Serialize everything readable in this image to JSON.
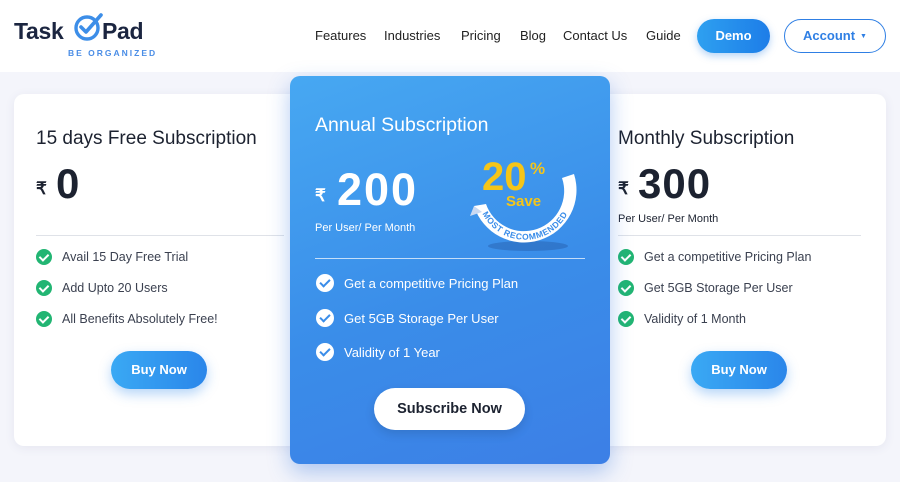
{
  "header": {
    "logo": {
      "word1": "Task",
      "word2": "Pad",
      "tagline": "BE ORGANIZED"
    },
    "nav": [
      {
        "label": "Features"
      },
      {
        "label": "Industries"
      },
      {
        "label": "Pricing"
      },
      {
        "label": "Blog"
      },
      {
        "label": "Contact Us"
      },
      {
        "label": "Guide"
      }
    ],
    "demo_label": "Demo",
    "account_label": "Account"
  },
  "plans": {
    "free": {
      "title": "15 days Free Subscription",
      "currency": "₹",
      "price": "0",
      "features": [
        "Avail 15 Day Free Trial",
        "Add Upto 20 Users",
        "All Benefits Absolutely Free!"
      ],
      "button": "Buy Now"
    },
    "annual": {
      "title": "Annual Subscription",
      "currency": "₹",
      "price": "200",
      "per": "Per User/ Per Month",
      "badge": {
        "percent": "20",
        "symbol": "%",
        "save": "Save",
        "ribbon": "MOST RECOMMENDED"
      },
      "features": [
        "Get a competitive Pricing Plan",
        "Get 5GB Storage Per User",
        "Validity of 1 Year"
      ],
      "button": "Subscribe Now"
    },
    "monthly": {
      "title": "Monthly Subscription",
      "currency": "₹",
      "price": "300",
      "per": "Per User/ Per Month",
      "features": [
        "Get a competitive Pricing Plan",
        "Get 5GB Storage Per User",
        "Validity of 1 Month"
      ],
      "button": "Buy Now"
    }
  },
  "colors": {
    "brand_blue": "#2f7fe4",
    "featured_gradient_start": "#47a8f2",
    "featured_gradient_end": "#3c7fe6",
    "check_green": "#22b573",
    "badge_yellow": "#f5c518"
  }
}
